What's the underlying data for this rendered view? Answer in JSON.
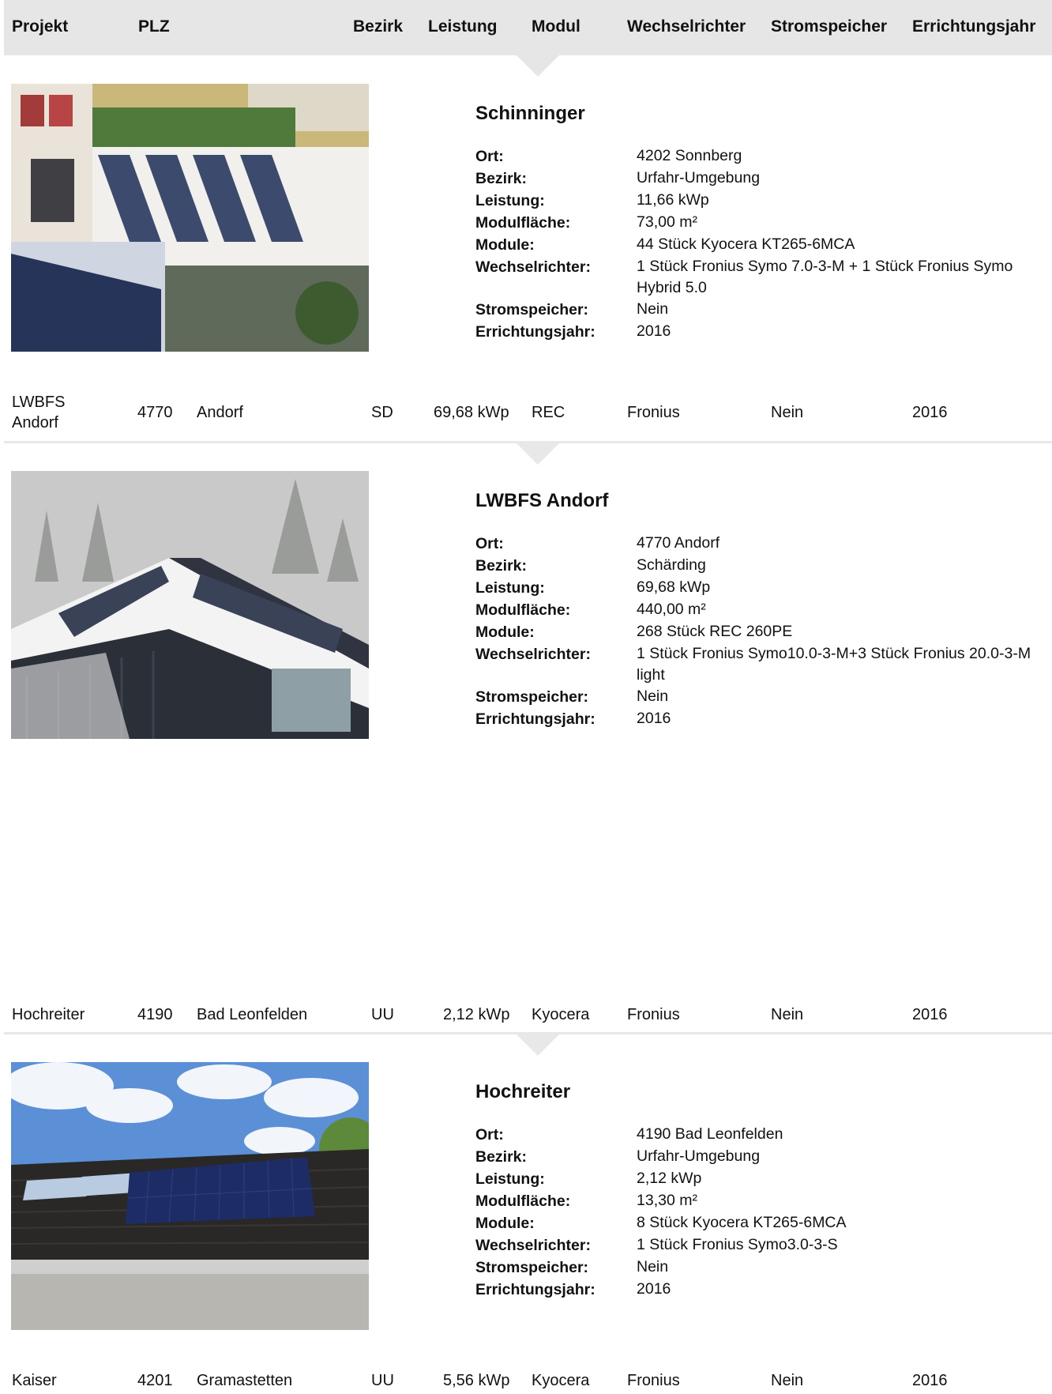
{
  "columns": {
    "projekt": "Projekt",
    "plz": "PLZ",
    "bezirk": "Bezirk",
    "leistung": "Leistung",
    "modul": "Modul",
    "wechselrichter": "Wechselrichter",
    "stromspeicher": "Stromspeicher",
    "errichtungsjahr": "Errichtungsjahr"
  },
  "labels": {
    "ort": "Ort:",
    "bezirk": "Bezirk:",
    "leistung": "Leistung:",
    "modulflaeche": "Modulfläche:",
    "module": "Module:",
    "wechselrichter": "Wechselrichter:",
    "stromspeicher": "Stromspeicher:",
    "errichtungsjahr": "Errichtungsjahr:"
  },
  "projects": [
    {
      "detail": {
        "title": "Schinninger",
        "ort": "4202 Sonnberg",
        "bezirk": "Urfahr-Umgebung",
        "leistung": "11,66 kWp",
        "modulflaeche": "73,00 m²",
        "module": "44 Stück Kyocera KT265-6MCA",
        "wechselrichter": "1 Stück Fronius Symo 7.0-3-M + 1 Stück Fronius Symo Hybrid 5.0",
        "stromspeicher": "Nein",
        "errichtungsjahr": "2016"
      }
    },
    {
      "row": {
        "projekt": "LWBFS Andorf",
        "plz": "4770",
        "ort": "Andorf",
        "bezirk": "SD",
        "leistung": "69,68 kWp",
        "modul": "REC",
        "wechselrichter": "Fronius",
        "stromspeicher": "Nein",
        "errichtungsjahr": "2016"
      },
      "detail": {
        "title": "LWBFS Andorf",
        "ort": "4770 Andorf",
        "bezirk": "Schärding",
        "leistung": "69,68 kWp",
        "modulflaeche": "440,00 m²",
        "module": "268 Stück REC 260PE",
        "wechselrichter": "1 Stück Fronius Symo10.0-3-M+3 Stück Fronius 20.0-3-M light",
        "stromspeicher": "Nein",
        "errichtungsjahr": "2016"
      }
    },
    {
      "row": {
        "projekt": "Hochreiter",
        "plz": "4190",
        "ort": "Bad Leonfelden",
        "bezirk": "UU",
        "leistung": "2,12 kWp",
        "modul": "Kyocera",
        "wechselrichter": "Fronius",
        "stromspeicher": "Nein",
        "errichtungsjahr": "2016"
      },
      "detail": {
        "title": "Hochreiter",
        "ort": "4190 Bad Leonfelden",
        "bezirk": "Urfahr-Umgebung",
        "leistung": "2,12 kWp",
        "modulflaeche": "13,30 m²",
        "module": "8 Stück Kyocera KT265-6MCA",
        "wechselrichter": "1 Stück Fronius Symo3.0-3-S",
        "stromspeicher": "Nein",
        "errichtungsjahr": "2016"
      }
    },
    {
      "row": {
        "projekt": "Kaiser",
        "plz": "4201",
        "ort": "Gramastetten",
        "bezirk": "UU",
        "leistung": "5,56 kWp",
        "modul": "Kyocera",
        "wechselrichter": "Fronius",
        "stromspeicher": "Nein",
        "errichtungsjahr": "2016"
      }
    }
  ]
}
